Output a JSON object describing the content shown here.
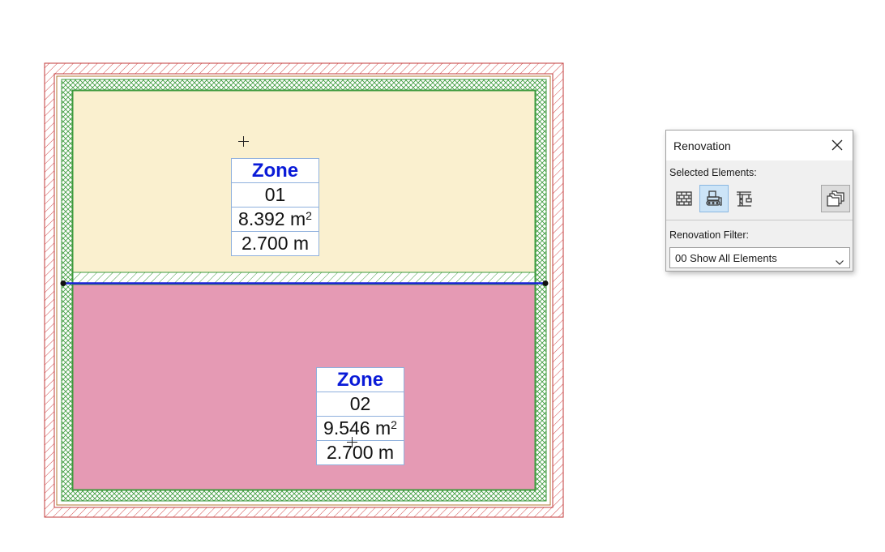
{
  "zones": [
    {
      "title": "Zone",
      "number": "01",
      "area_value": "8.392 m",
      "area_exp": "2",
      "height": "2.700 m",
      "fill_color": "#faf0cf"
    },
    {
      "title": "Zone",
      "number": "02",
      "area_value": "9.546 m",
      "area_exp": "2",
      "height": "2.700 m",
      "fill_color": "#e59ab4"
    }
  ],
  "colors": {
    "outer_wall_hatch": "#d44b4b",
    "inner_wall_hatch": "#3c9a3c",
    "selected_line": "#1a20d8",
    "zone_title": "#0a1bd8",
    "stamp_border": "#8fb0dd"
  },
  "renovation_palette": {
    "title": "Renovation",
    "selected_elements_label": "Selected Elements:",
    "status_buttons": [
      {
        "icon": "existing-brick-wall-icon",
        "state": "normal"
      },
      {
        "icon": "bulldozer-demolish-icon",
        "state": "active"
      },
      {
        "icon": "crane-new-construction-icon",
        "state": "normal"
      }
    ],
    "override_button": {
      "icon": "layered-folders-icon",
      "state": "pressed"
    },
    "filter_label": "Renovation Filter:",
    "filter_value": "00 Show All Elements"
  }
}
